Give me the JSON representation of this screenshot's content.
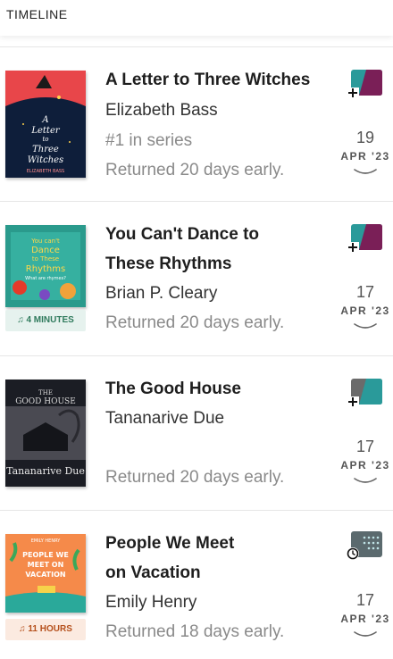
{
  "header": {
    "title": "TIMELINE"
  },
  "entries": [
    {
      "title_lines": [
        "A Letter to Three Witches"
      ],
      "author": "Elizabeth Bass",
      "series": "#1 in series",
      "status": "Returned 20 days early.",
      "day": "19",
      "month": "APR '23",
      "badge": "add-to-list",
      "cover_colors": [
        "#e8464a",
        "#0e1e3a"
      ],
      "cover_text": [
        "A",
        "Letter",
        "to",
        "Three",
        "Witches",
        "ELIZABETH BASS"
      ]
    },
    {
      "title_lines": [
        "You Can't Dance to",
        "These Rhythms"
      ],
      "author": "Brian P. Cleary",
      "status": "Returned 20 days early.",
      "day": "17",
      "month": "APR '23",
      "badge": "add-to-list",
      "duration": "4 MINUTES",
      "cover_colors": [
        "#2a9a8c",
        "#e53a2a"
      ],
      "cover_text": [
        "You can't",
        "Dance",
        "to These",
        "Rhythms",
        "What are rhymes?"
      ]
    },
    {
      "title_lines": [
        "The Good House"
      ],
      "author": "Tananarive Due",
      "status": "Returned 20 days early.",
      "day": "17",
      "month": "APR '23",
      "badge": "add-to-list",
      "cover_colors": [
        "#1b1d24",
        "#4a4a52"
      ],
      "cover_text": [
        "THE",
        "GOOD HOUSE",
        "Tananarive Due"
      ]
    },
    {
      "title_lines": [
        "People We Meet",
        "on Vacation"
      ],
      "author": "Emily Henry",
      "status": "Returned 18 days early.",
      "day": "17",
      "month": "APR '23",
      "badge": "on-hold",
      "duration": "11 HOURS",
      "cover_colors": [
        "#f58a4a",
        "#2aa99a"
      ],
      "cover_text": [
        "EMILY HENRY",
        "PEOPLE WE",
        "MEET ON",
        "VACATION"
      ]
    }
  ]
}
